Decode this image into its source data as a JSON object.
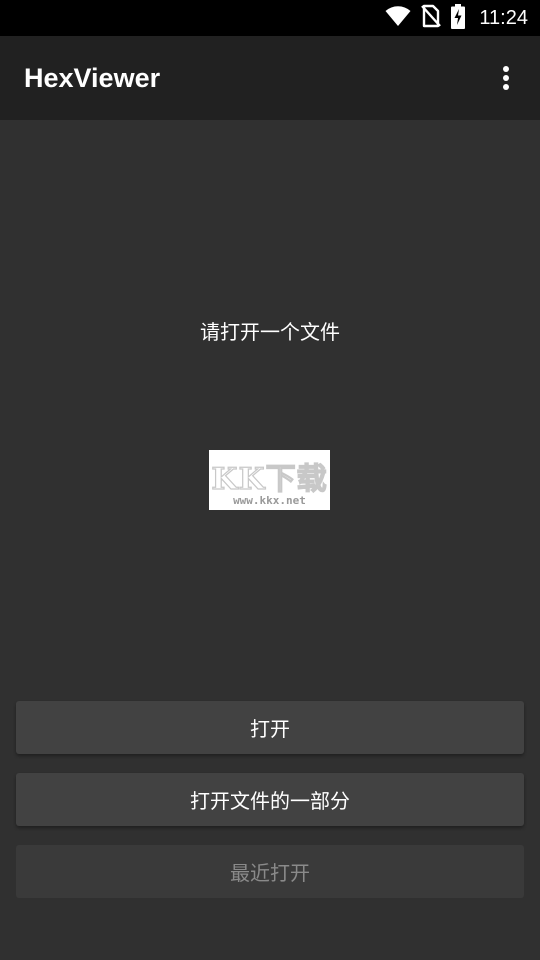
{
  "status_bar": {
    "time": "11:24",
    "icons": [
      "wifi-icon",
      "no-sim-icon",
      "battery-charging-icon"
    ]
  },
  "app_bar": {
    "title": "HexViewer",
    "overflow_icon": "more-vert-icon"
  },
  "main": {
    "hint": "请打开一个文件",
    "watermark": {
      "logo": "KK下载",
      "url": "www.kkx.net"
    }
  },
  "buttons": {
    "open": "打开",
    "open_partial": "打开文件的一部分",
    "recent": "最近打开"
  },
  "colors": {
    "status_bar_bg": "#000000",
    "app_bar_bg": "#212121",
    "background": "#303030",
    "button_bg": "#424242",
    "disabled_text": "#8a8a8a"
  }
}
